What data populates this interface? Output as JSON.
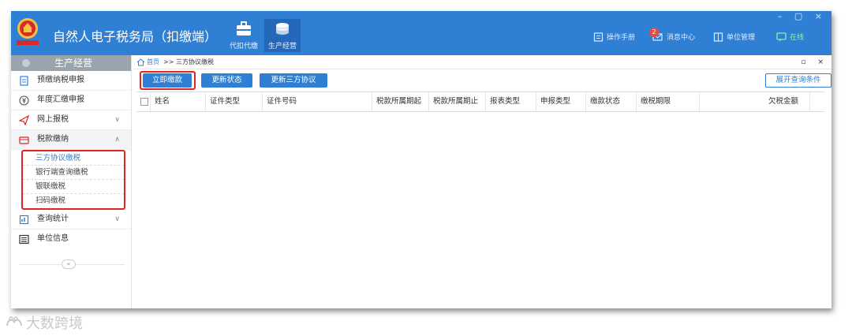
{
  "app": {
    "title": "自然人电子税务局（扣缴端）",
    "window_controls": "– ▢ ×"
  },
  "topnav": [
    {
      "label": "代扣代缴",
      "icon": "briefcase-icon",
      "active": false
    },
    {
      "label": "生产经营",
      "icon": "coins-icon",
      "active": true
    }
  ],
  "toplinks": {
    "manual": "操作手册",
    "messages": "消息中心",
    "messages_badge": "2",
    "unit_mgmt": "单位管理",
    "online": "在线"
  },
  "sidebar": {
    "header": "生产经营",
    "items": [
      {
        "label": "预缴纳税申报",
        "icon": "document-icon",
        "chevron": ""
      },
      {
        "label": "年度汇缴申报",
        "icon": "yen-circle-icon",
        "chevron": ""
      },
      {
        "label": "网上报税",
        "icon": "send-icon",
        "chevron": "∨"
      },
      {
        "label": "税款缴纳",
        "icon": "payment-icon",
        "chevron": "∧"
      }
    ],
    "submenu": [
      {
        "label": "三方协议缴税",
        "active": true
      },
      {
        "label": "银行端查询缴税",
        "active": false
      },
      {
        "label": "银联缴税",
        "active": false
      },
      {
        "label": "扫码缴税",
        "active": false
      }
    ],
    "items_after": [
      {
        "label": "查询统计",
        "icon": "chart-icon",
        "chevron": "∨"
      },
      {
        "label": "单位信息",
        "icon": "list-icon",
        "chevron": ""
      }
    ],
    "collapse": "«"
  },
  "breadcrumb": {
    "home": "首页",
    "separator": ">>",
    "current": "三方协议缴税",
    "tab_controls": "▫ ×"
  },
  "toolbar": {
    "pay_now": "立即缴款",
    "update_status": "更新状态",
    "update_agreement": "更新三方协议",
    "expand_query": "展开查询条件"
  },
  "grid": {
    "columns": [
      "姓名",
      "证件类型",
      "证件号码",
      "税款所属期起",
      "税款所属期止",
      "报表类型",
      "申报类型",
      "缴款状态",
      "缴税期限",
      "欠税金额"
    ],
    "rows": []
  },
  "watermark": "大数跨境",
  "colors": {
    "primary": "#2f80d4",
    "highlight": "#e02424",
    "sidebar_header": "#9aa4ad",
    "online": "#8ef0a2"
  }
}
